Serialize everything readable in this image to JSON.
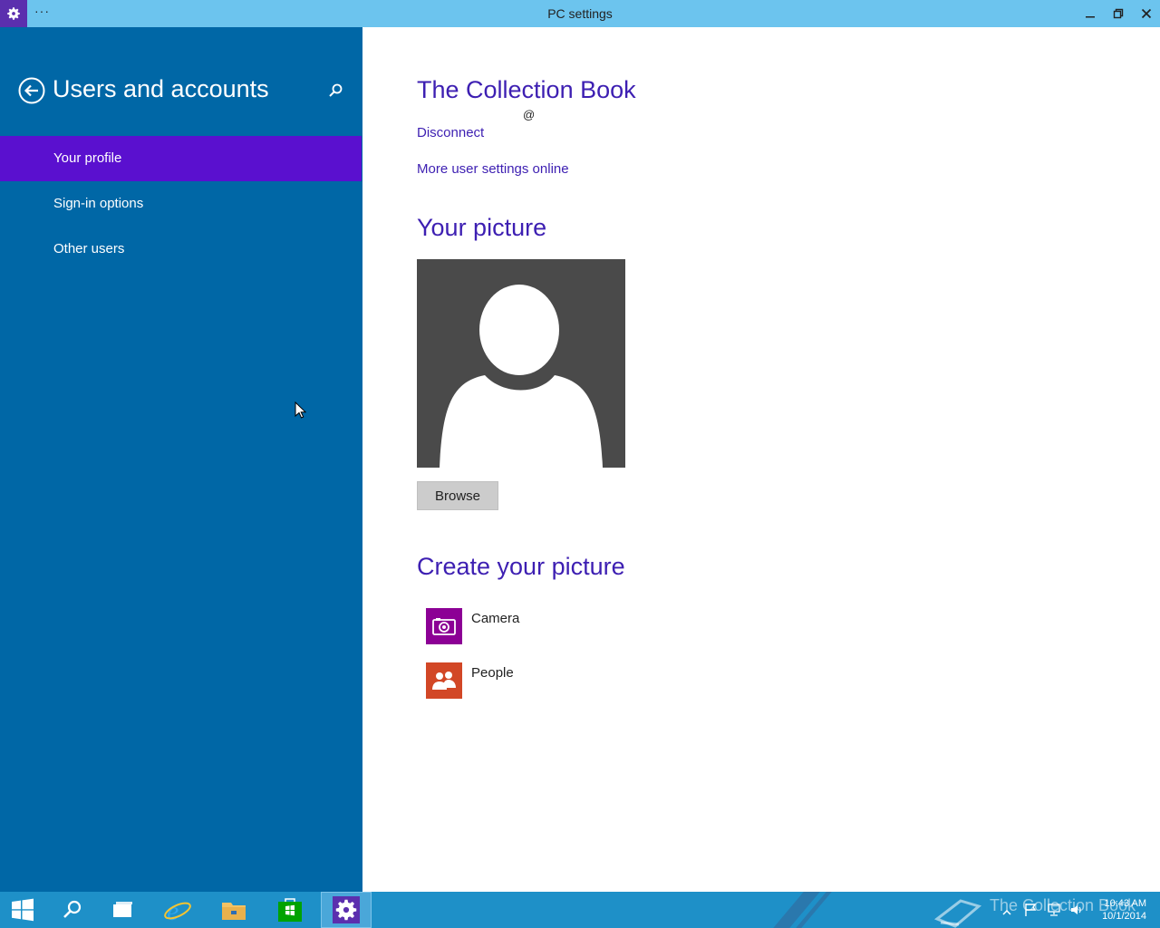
{
  "window": {
    "title": "PC settings",
    "menu_dots": "···"
  },
  "sidebar": {
    "title": "Users and accounts",
    "items": [
      {
        "label": "Your profile",
        "active": true
      },
      {
        "label": "Sign-in options",
        "active": false
      },
      {
        "label": "Other users",
        "active": false
      }
    ]
  },
  "main": {
    "account_name": "The Collection Book",
    "account_email": "@",
    "disconnect_label": "Disconnect",
    "more_settings_label": "More user settings online",
    "your_picture_heading": "Your picture",
    "browse_label": "Browse",
    "create_heading": "Create your picture",
    "create_options": [
      {
        "label": "Camera",
        "icon": "camera-icon",
        "color": "#8c0095"
      },
      {
        "label": "People",
        "icon": "people-icon",
        "color": "#d24726"
      }
    ]
  },
  "taskbar": {
    "watermark": "The Collection Book",
    "time": "10:43 AM",
    "date": "10/1/2014",
    "items": [
      "start-icon",
      "search-icon",
      "task-view-icon",
      "internet-explorer-icon",
      "file-explorer-icon",
      "store-icon",
      "settings-icon"
    ]
  },
  "colors": {
    "sidebar": "#0067a6",
    "selected": "#5a10cf",
    "accent_text": "#3d1fb2",
    "titlebar": "#6cc4ee",
    "taskbar": "#1e90c8"
  }
}
